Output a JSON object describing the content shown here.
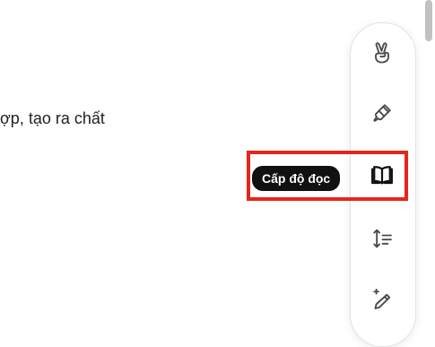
{
  "content": {
    "visible_text": "ợp, tạo ra chất"
  },
  "toolbar": {
    "items": [
      {
        "name": "emoji",
        "icon": "victory-hand-icon"
      },
      {
        "name": "style",
        "icon": "paintbrush-icon"
      },
      {
        "name": "reading-level",
        "icon": "open-book-icon",
        "tooltip": "Cấp độ đọc",
        "active": true
      },
      {
        "name": "length",
        "icon": "text-length-icon"
      },
      {
        "name": "polish",
        "icon": "sparkle-pencil-icon"
      }
    ]
  },
  "colors": {
    "highlight": "#e8241a",
    "tooltip_bg": "#111111",
    "toolbar_bg": "#ffffff",
    "scrollbar_thumb": "#c1c1c1"
  }
}
